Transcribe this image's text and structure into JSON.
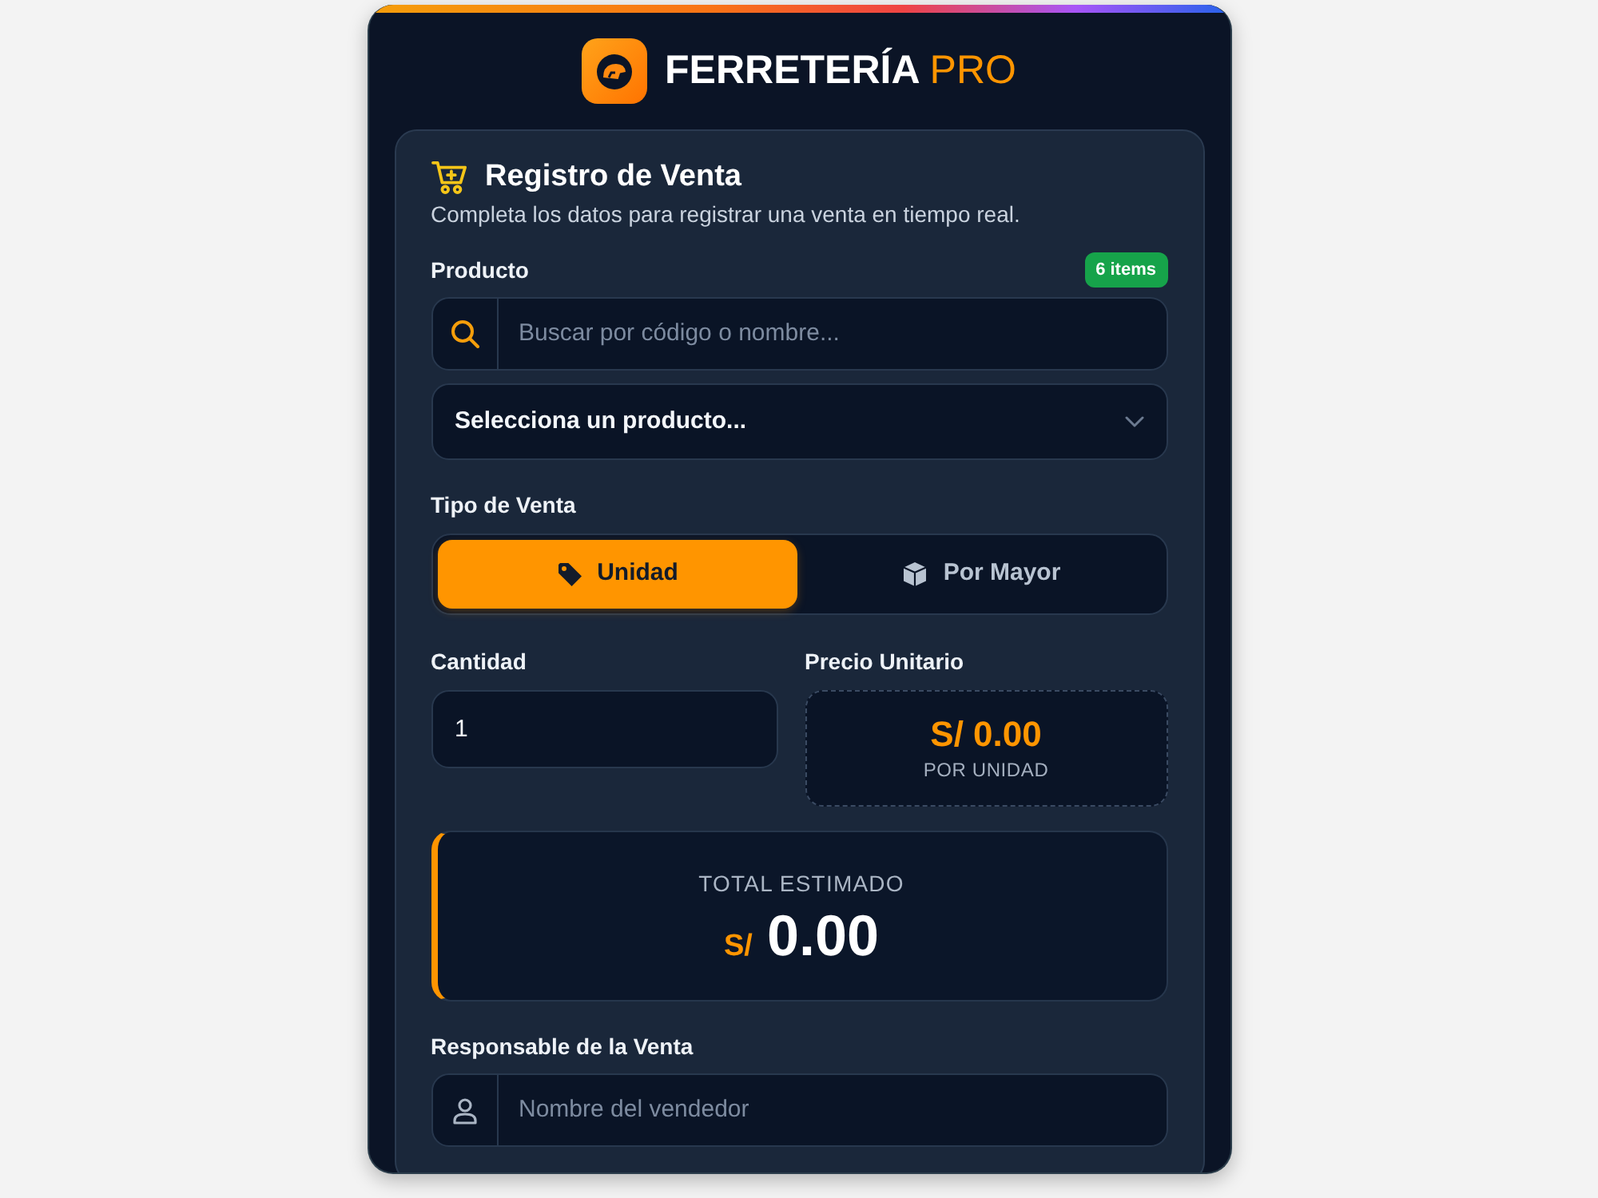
{
  "brand": {
    "name": "FERRETERÍA",
    "suffix": "PRO"
  },
  "form": {
    "title": "Registro de Venta",
    "subtitle": "Completa los datos para registrar una venta en tiempo real.",
    "product": {
      "label": "Producto",
      "badge": "6 items",
      "search": {
        "placeholder": "Buscar por código o nombre..."
      },
      "select": {
        "value": "Selecciona un producto..."
      }
    },
    "sale_type": {
      "label": "Tipo de Venta",
      "options": [
        {
          "label": "Unidad",
          "selected": true
        },
        {
          "label": "Por Mayor",
          "selected": false
        }
      ]
    },
    "quantity": {
      "label": "Cantidad",
      "value": "1"
    },
    "unit_price": {
      "label": "Precio Unitario",
      "amount": "S/ 0.00",
      "caption": "POR UNIDAD"
    },
    "total": {
      "label": "TOTAL ESTIMADO",
      "currency": "S/",
      "amount": "0.00"
    },
    "seller": {
      "label": "Responsable de la Venta",
      "placeholder": "Nombre del vendedor"
    }
  }
}
